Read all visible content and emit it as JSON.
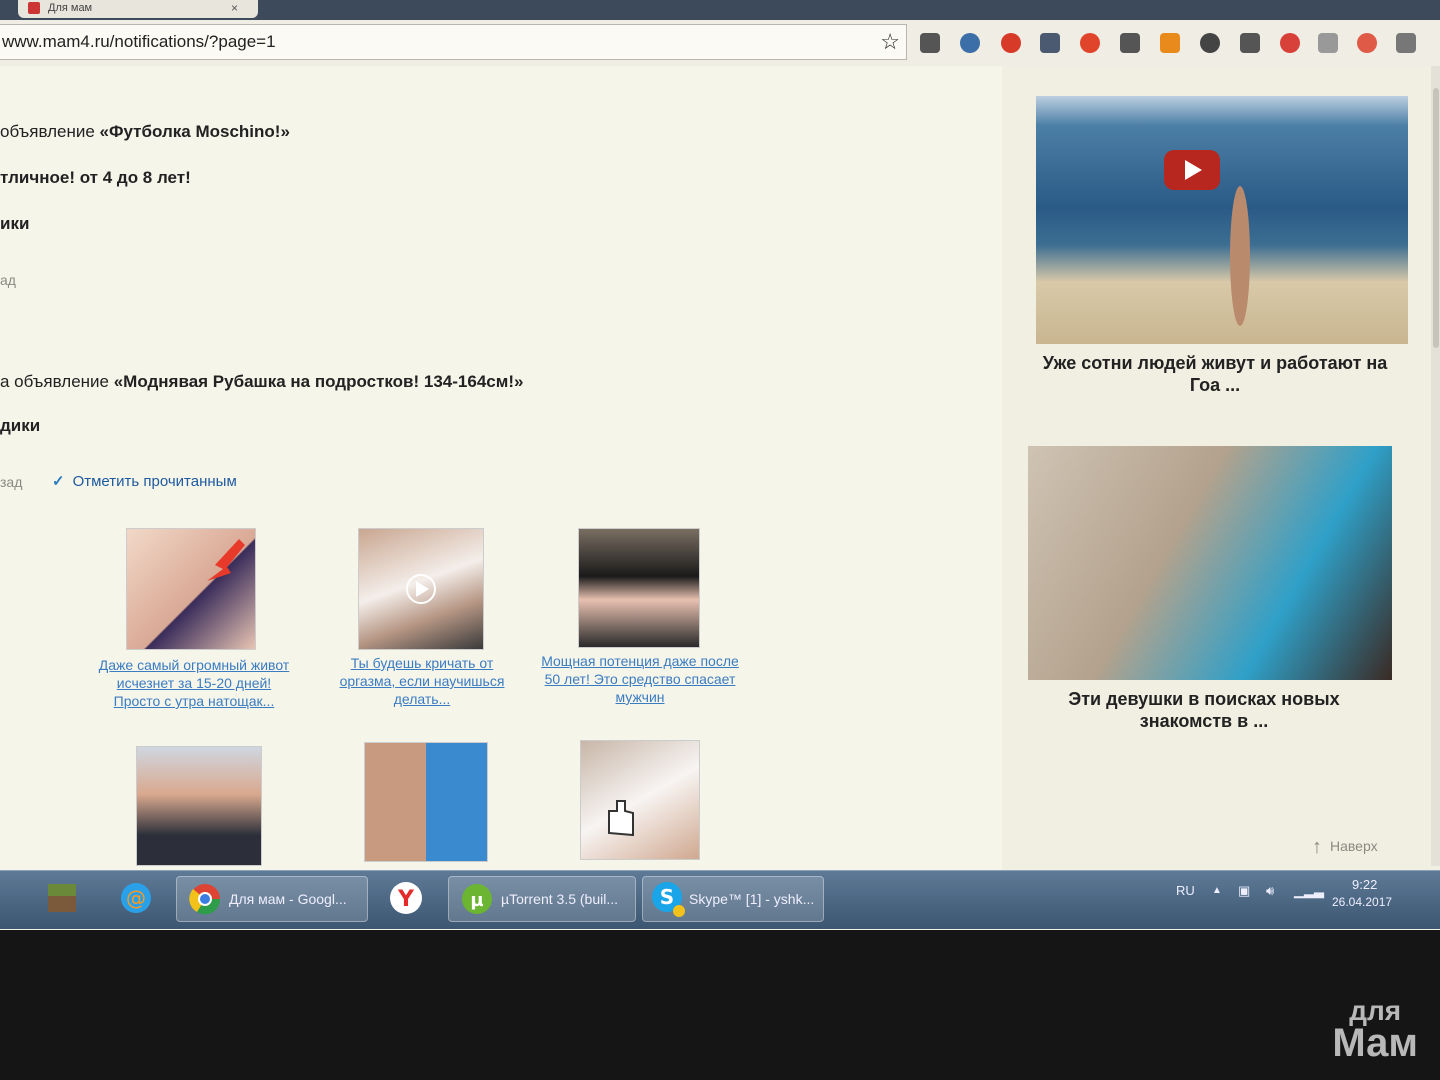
{
  "browser": {
    "tab_title": "Для мам",
    "tab_close": "×",
    "url": "www.mam4.ru/notifications/?page=1"
  },
  "notifications": [
    {
      "prefix": "объявление ",
      "title": "«Футболка Moschino!»"
    },
    {
      "line2": "тличное! от 4 до 8 лет!",
      "line3": "ики",
      "meta": "ад"
    },
    {
      "prefix": "а объявление ",
      "title": "«Моднявая Рубашка на подростков! 134-164см!»"
    },
    {
      "line3": "дики",
      "meta": "зад"
    }
  ],
  "mark_read": {
    "check": "✓",
    "label": "Отметить прочитанным"
  },
  "thumbs": [
    {
      "caption": "Даже самый огромный живот исчезнет за 15-20 дней! Просто с утра натощак..."
    },
    {
      "caption": "Ты будешь кричать от оргазма, если научишься делать..."
    },
    {
      "caption": "Мощная потенция даже после 50 лет! Это средство спасает мужчин"
    }
  ],
  "ads": [
    {
      "caption": "Уже сотни людей живут и работают на Гоа ..."
    },
    {
      "caption": "Эти девушки в поисках новых знакомств в ..."
    }
  ],
  "to_top": {
    "arrow": "↑",
    "label": "Наверх"
  },
  "taskbar": {
    "chrome_label": "Для мам - Googl...",
    "utorrent_label": "µTorrent 3.5  (buil...",
    "skype_label": "Skype™ [1] - yshk...",
    "lang": "RU",
    "time": "9:22",
    "date": "26.04.2017"
  },
  "watermark": {
    "top": "для",
    "bottom": "Мам"
  },
  "colors": {
    "link": "#3a7cc2",
    "page_bg": "#f6f5ea",
    "taskbar": "#4a6684"
  }
}
